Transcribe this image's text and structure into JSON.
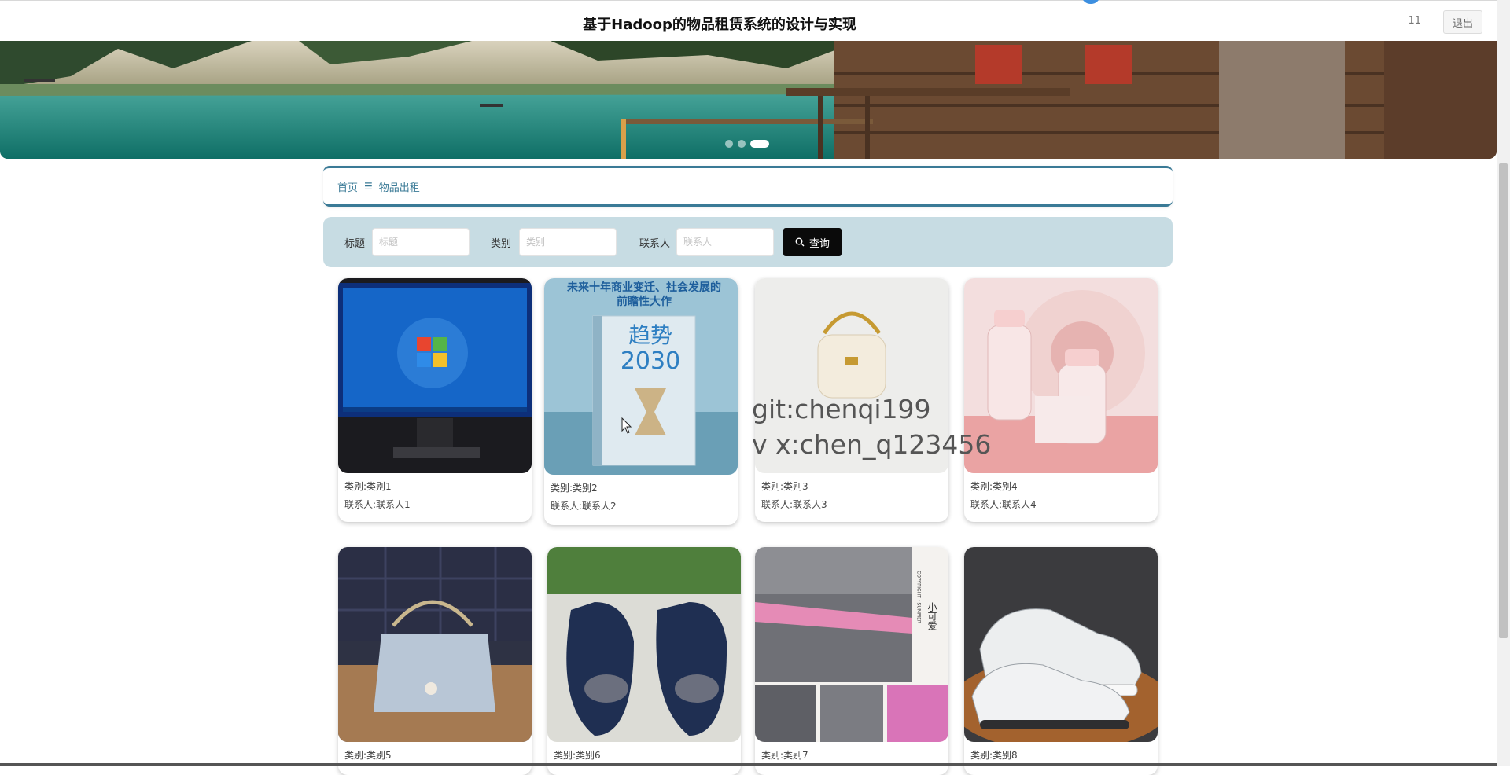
{
  "header": {
    "title": "基于Hadoop的物品租赁系统的设计与实现",
    "user_count": "11",
    "logout_label": "退出"
  },
  "banner": {
    "slide_count": 3,
    "active_slide": 3
  },
  "breadcrumb": {
    "home": "首页",
    "separator": "☰",
    "current": "物品出租"
  },
  "search": {
    "title_label": "标题",
    "title_placeholder": "标题",
    "category_label": "类别",
    "category_placeholder": "类别",
    "contact_label": "联系人",
    "contact_placeholder": "联系人",
    "query_label": "查询"
  },
  "items": [
    {
      "category": "类别:类别1",
      "contact": "联系人:联系人1",
      "image": "monitor-photo"
    },
    {
      "category": "类别:类别2",
      "contact": "联系人:联系人2",
      "image": "book-photo",
      "image_text_1": "未来十年商业变迁、社会发展的",
      "image_text_2": "前瞻性大作",
      "image_text_3": "趋势",
      "image_text_4": "2030"
    },
    {
      "category": "类别:类别3",
      "contact": "联系人:联系人3",
      "image": "handbag-photo"
    },
    {
      "category": "类别:类别4",
      "contact": "联系人:联系人4",
      "image": "baby-bottle-photo"
    },
    {
      "category": "类别:类别5",
      "image": "purse-photo"
    },
    {
      "category": "类别:类别6",
      "image": "shoes-photo"
    },
    {
      "category": "类别:类别7",
      "image": "bedding-photo",
      "image_text_1": "小可爱",
      "image_text_2": "COPYRIGHT · SUMMER"
    },
    {
      "category": "类别:类别8",
      "image": "sneaker-photo"
    }
  ],
  "watermark": {
    "line1": "git:chenqi199",
    "line2": "v x:chen_q123456"
  },
  "colors": {
    "accent": "#3a7a96",
    "search_bg": "#c7dce3",
    "query_button": "#0a0a0a"
  }
}
